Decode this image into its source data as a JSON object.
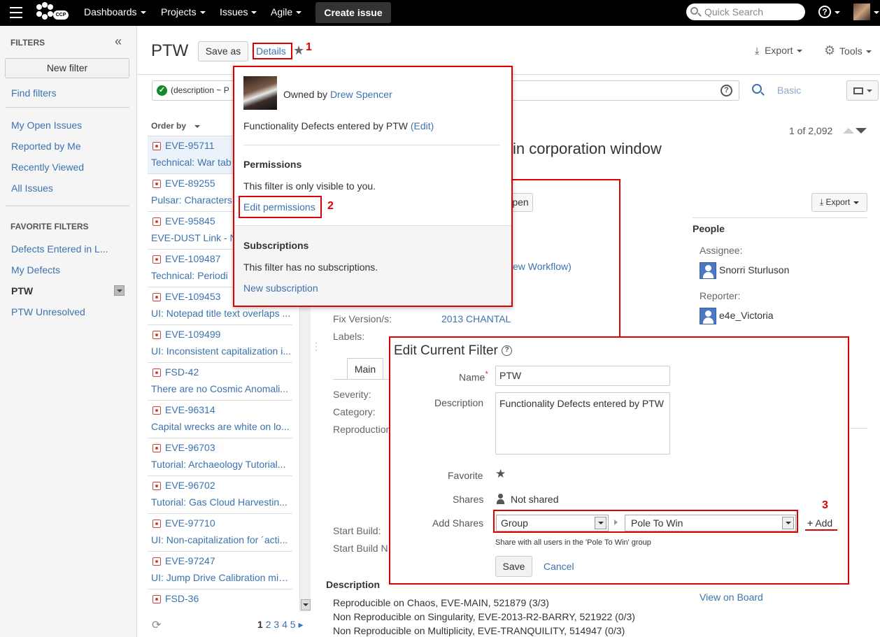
{
  "nav": {
    "logo_text": "CCP",
    "items": [
      {
        "label": "Dashboards"
      },
      {
        "label": "Projects"
      },
      {
        "label": "Issues"
      },
      {
        "label": "Agile"
      }
    ],
    "create_label": "Create issue",
    "search_placeholder": "Quick Search",
    "help_icon": "help-icon",
    "avatar": "user-avatar"
  },
  "sidebar": {
    "title": "FILTERS",
    "collapse_icon": "«",
    "new_filter": "New filter",
    "find_filters": "Find filters",
    "links": [
      "My Open Issues",
      "Reported by Me",
      "Recently Viewed",
      "All Issues"
    ],
    "favorites_title": "FAVORITE FILTERS",
    "favorites": [
      "Defects Entered in L...",
      "My Defects",
      "PTW",
      "PTW Unresolved"
    ]
  },
  "header": {
    "title": "PTW",
    "save_as": "Save as",
    "details": "Details",
    "export": "Export",
    "tools": "Tools"
  },
  "search": {
    "query": "(description ~ P",
    "basic": "Basic"
  },
  "list": {
    "order_by": "Order by",
    "issues": [
      {
        "key": "EVE-95711",
        "summary": "Technical: War tab"
      },
      {
        "key": "EVE-89255",
        "summary": "Pulsar: Characters"
      },
      {
        "key": "EVE-95845",
        "summary": "EVE-DUST Link - N"
      },
      {
        "key": "EVE-109487",
        "summary": "Technical: Periodi"
      },
      {
        "key": "EVE-109453",
        "summary": "UI: Notepad title text overlaps ..."
      },
      {
        "key": "EVE-109499",
        "summary": "UI: Inconsistent capitalization i..."
      },
      {
        "key": "FSD-42",
        "summary": "There are no Cosmic Anomali..."
      },
      {
        "key": "EVE-96314",
        "summary": "Capital wrecks are white on lo..."
      },
      {
        "key": "EVE-96703",
        "summary": "Tutorial: Archaeology Tutorial..."
      },
      {
        "key": "EVE-96702",
        "summary": "Tutorial: Gas Cloud Harvestin..."
      },
      {
        "key": "EVE-97710",
        "summary": "UI: Non-capitalization for ´acti..."
      },
      {
        "key": "EVE-97247",
        "summary": "UI: Jump Drive Calibration mis..."
      },
      {
        "key": "FSD-36",
        "summary": ""
      }
    ],
    "pages": [
      "1",
      "2",
      "3",
      "4",
      "5"
    ],
    "next": "▸"
  },
  "detail": {
    "counter": "1 of 2,092",
    "title_fragment": "in corporation window",
    "open_fragment": "pen",
    "workflow_fragment": "ew Workflow)",
    "export": "Export",
    "fix_version_label": "Fix Version/s:",
    "fix_version_value": "2013 CHANTAL",
    "labels_label": "Labels:",
    "tab_main": "Main",
    "severity_label": "Severity:",
    "category_label": "Category:",
    "reproduction_label": "Reproduction",
    "start_build_label": "Start Build:",
    "start_build_n_label": "Start Build N",
    "people_title": "People",
    "assignee_label": "Assignee:",
    "assignee": "Snorri Sturluson",
    "reporter_label": "Reporter:",
    "reporter": "e4e_Victoria",
    "description_title": "Description",
    "view_on_board": "View on Board",
    "description_lines": [
      "Reproducible on Chaos, EVE-MAIN, 521879 (3/3)",
      "Non Reproducible on Singularity, EVE-2013-R2-BARRY, 521922 (0/3)",
      "Non Reproducible on Multiplicity, EVE-TRANQUILITY, 514947 (0/3)"
    ]
  },
  "details_popup": {
    "owned_by": "Owned by",
    "owner": "Drew Spencer",
    "description": "Functionality Defects entered by PTW",
    "edit": "(Edit)",
    "permissions_title": "Permissions",
    "permissions_text": "This filter is only visible to you.",
    "edit_permissions": "Edit permissions",
    "subscriptions_title": "Subscriptions",
    "subscriptions_text": "This filter has no subscriptions.",
    "new_subscription": "New subscription"
  },
  "edit_dialog": {
    "title": "Edit Current Filter",
    "name_label": "Name",
    "required": "*",
    "name_value": "PTW",
    "description_label": "Description",
    "description_value": "Functionality Defects entered by PTW",
    "favorite_label": "Favorite",
    "shares_label": "Shares",
    "shares_value": "Not shared",
    "add_shares_label": "Add Shares",
    "share_type": "Group",
    "share_group": "Pole To Win",
    "add": "Add",
    "hint": "Share with all users in the 'Pole To Win' group",
    "save": "Save",
    "cancel": "Cancel"
  },
  "annotations": [
    "1",
    "2",
    "3"
  ],
  "colors": {
    "annotation": "#e00000",
    "link": "#3b73af",
    "topbar": "#000000"
  }
}
